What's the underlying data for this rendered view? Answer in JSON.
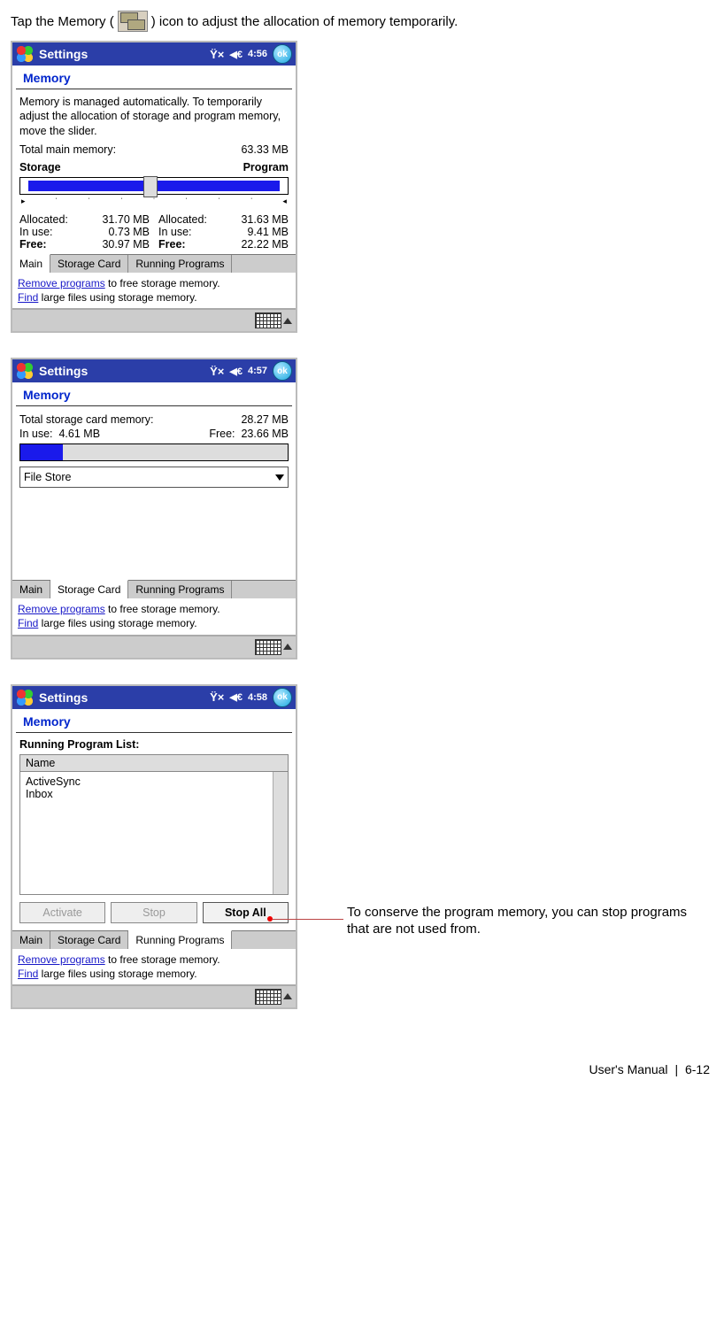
{
  "intro": {
    "before": "Tap the Memory (",
    "after": ") icon to adjust the allocation of memory temporarily."
  },
  "common": {
    "titlebar_title": "Settings",
    "ok": "ok",
    "header": "Memory",
    "tabs": {
      "main": "Main",
      "storage": "Storage Card",
      "running": "Running Programs"
    },
    "hints": {
      "remove_link": "Remove programs",
      "remove_rest": " to free storage memory.",
      "find_link": "Find",
      "find_rest": " large files using storage memory."
    }
  },
  "s1": {
    "time": "4:56",
    "instr": "Memory is managed automatically. To temporarily adjust the allocation of storage and program memory, move the slider.",
    "total_label": "Total main memory:",
    "total_value": "63.33 MB",
    "storage_label": "Storage",
    "program_label": "Program",
    "alloc_label": "Allocated:",
    "inuse_label": "In use:",
    "free_label": "Free:",
    "storage": {
      "allocated": "31.70 MB",
      "inuse": "0.73 MB",
      "free": "30.97 MB"
    },
    "program": {
      "allocated": "31.63 MB",
      "inuse": "9.41 MB",
      "free": "22.22 MB"
    }
  },
  "s2": {
    "time": "4:57",
    "total_label": "Total storage card memory:",
    "total_value": "28.27 MB",
    "inuse_label": "In use:",
    "inuse_value": "4.61 MB",
    "free_label": "Free:",
    "free_value": "23.66 MB",
    "dropdown_value": "File Store",
    "usage_pct": 16
  },
  "s3": {
    "time": "4:58",
    "list_header": "Running Program List:",
    "name_col": "Name",
    "items": [
      "ActiveSync",
      "Inbox"
    ],
    "btn_activate": "Activate",
    "btn_stop": "Stop",
    "btn_stopall": "Stop All"
  },
  "callout": "To conserve the program memory, you can stop programs that are not used from.",
  "footer": {
    "manual": "User's Manual",
    "page": "6-12"
  }
}
